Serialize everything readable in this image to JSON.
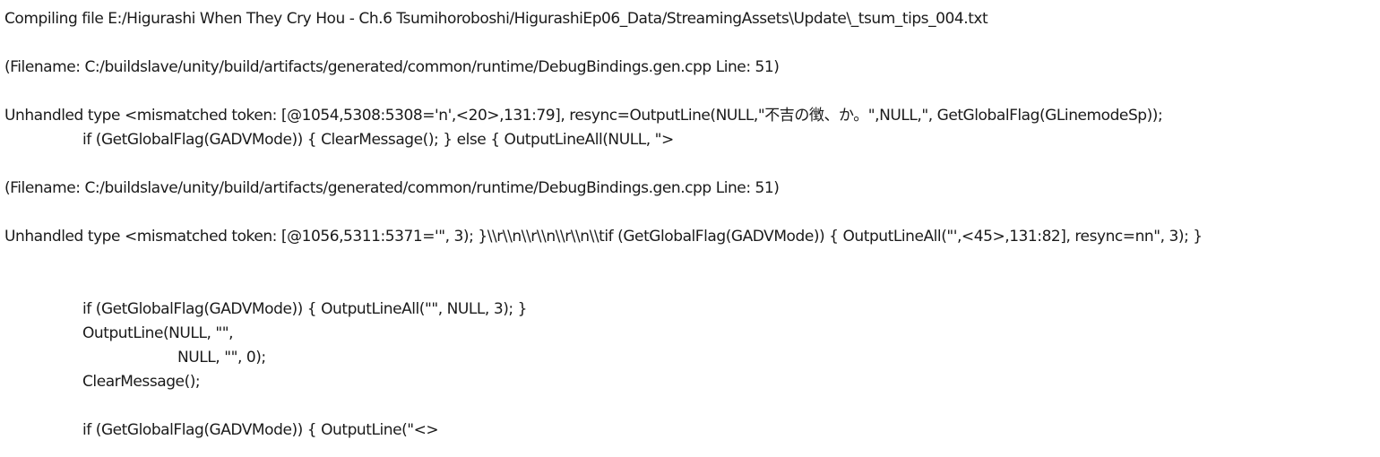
{
  "log": {
    "line_01": "Compiling file E:/Higurashi When They Cry Hou - Ch.6 Tsumihoroboshi/HigurashiEp06_Data/StreamingAssets\\Update\\_tsum_tips_004.txt",
    "line_02": "(Filename: C:/buildslave/unity/build/artifacts/generated/common/runtime/DebugBindings.gen.cpp Line: 51)",
    "line_03": "Unhandled type <mismatched token: [@1054,5308:5308='n',<20>,131:79], resync=OutputLine(NULL,\"不吉の徴、か。\",NULL,\", GetGlobalFlag(GLinemodeSp));",
    "line_04": "if (GetGlobalFlag(GADVMode)) { ClearMessage(); } else { OutputLineAll(NULL, \">",
    "line_05": "(Filename: C:/buildslave/unity/build/artifacts/generated/common/runtime/DebugBindings.gen.cpp Line: 51)",
    "line_06": "Unhandled type <mismatched token: [@1056,5311:5371='\", 3); }\\\\r\\\\n\\\\r\\\\n\\\\r\\\\n\\\\tif (GetGlobalFlag(GADVMode)) { OutputLineAll(\"',<45>,131:82], resync=nn\", 3); }",
    "line_07": "if (GetGlobalFlag(GADVMode)) { OutputLineAll(\"\", NULL, 3); }",
    "line_08": "OutputLine(NULL, \"\",",
    "line_09": "NULL, \"\", 0);",
    "line_10": "ClearMessage();",
    "line_11": "if (GetGlobalFlag(GADVMode)) { OutputLine(\"<>"
  }
}
